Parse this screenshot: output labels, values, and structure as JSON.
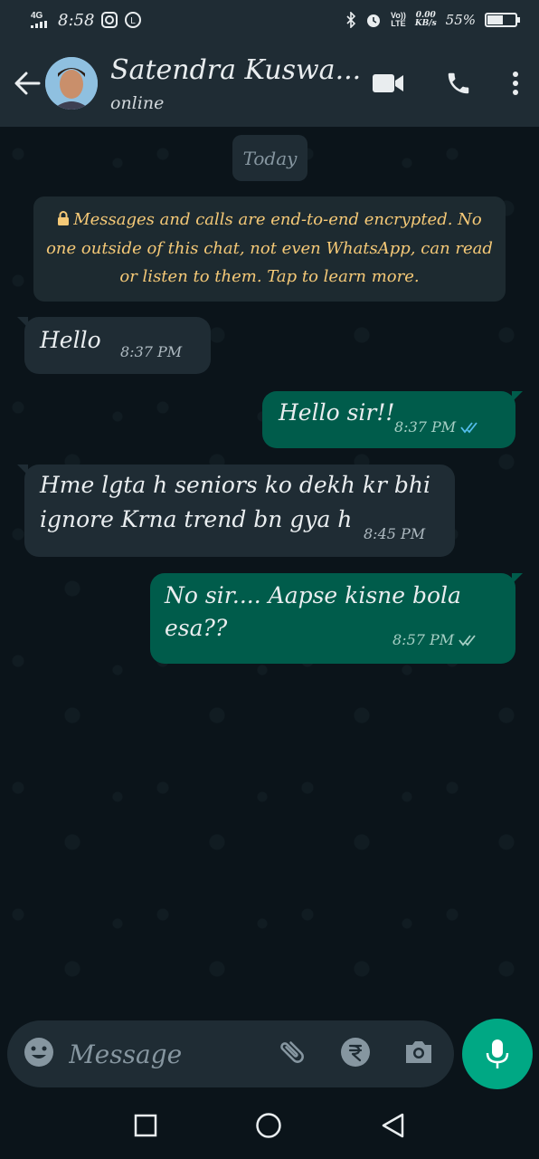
{
  "status_bar": {
    "network": "4G",
    "time": "8:58",
    "volte_line1": "Vo))",
    "volte_line2": "LTE",
    "speed_value": "0.00",
    "speed_unit": "KB/s",
    "battery_pct": "55%",
    "battery_level": 0.55
  },
  "header": {
    "contact_name": "Satendra Kuswa...",
    "status": "online",
    "icons": [
      "back-arrow-icon",
      "video-call-icon",
      "voice-call-icon",
      "more-options-icon"
    ]
  },
  "chat": {
    "date_chip": "Today",
    "encryption_notice": "Messages and calls are end-to-end encrypted. No one outside of this chat, not even WhatsApp, can read or listen to them. Tap to learn more.",
    "messages": [
      {
        "direction": "incoming",
        "text": "Hello",
        "time": "8:37 PM"
      },
      {
        "direction": "outgoing",
        "text": "Hello sir!!",
        "time": "8:37 PM",
        "ticks": "read"
      },
      {
        "direction": "incoming",
        "text_line1": "Hme lgta h seniors ko dekh kr bhi",
        "text_line2": "ignore Krna trend bn gya h",
        "time": "8:45 PM"
      },
      {
        "direction": "outgoing",
        "text": "No sir.... Aapse kisne bola esa??",
        "time": "8:57 PM",
        "ticks": "delivered"
      }
    ]
  },
  "input": {
    "placeholder": "Message"
  },
  "colors": {
    "background": "#0b141a",
    "header": "#1f2c34",
    "incoming_bubble": "#1f2c34",
    "outgoing_bubble": "#005c4b",
    "accent": "#00a884",
    "read_ticks": "#53bdeb",
    "notice_text": "#f5c977"
  }
}
